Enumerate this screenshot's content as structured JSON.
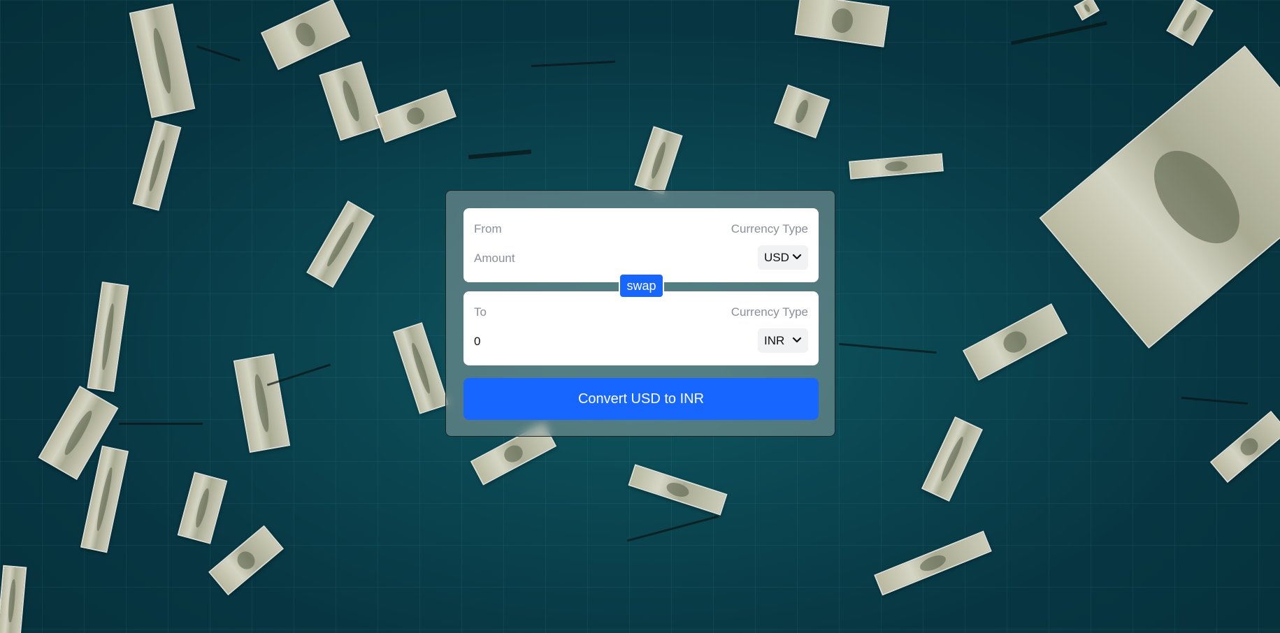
{
  "converter": {
    "from": {
      "label": "From",
      "currency_type_label": "Currency Type",
      "amount_placeholder": "Amount",
      "amount_value": "",
      "currency_selected": "USD"
    },
    "swap_label": "swap",
    "to": {
      "label": "To",
      "currency_type_label": "Currency Type",
      "amount_value": "0",
      "currency_selected": "INR"
    },
    "convert_label": "Convert USD to INR"
  },
  "colors": {
    "accent": "#1766ff",
    "background": "#073642",
    "panel": "#ffffff"
  }
}
